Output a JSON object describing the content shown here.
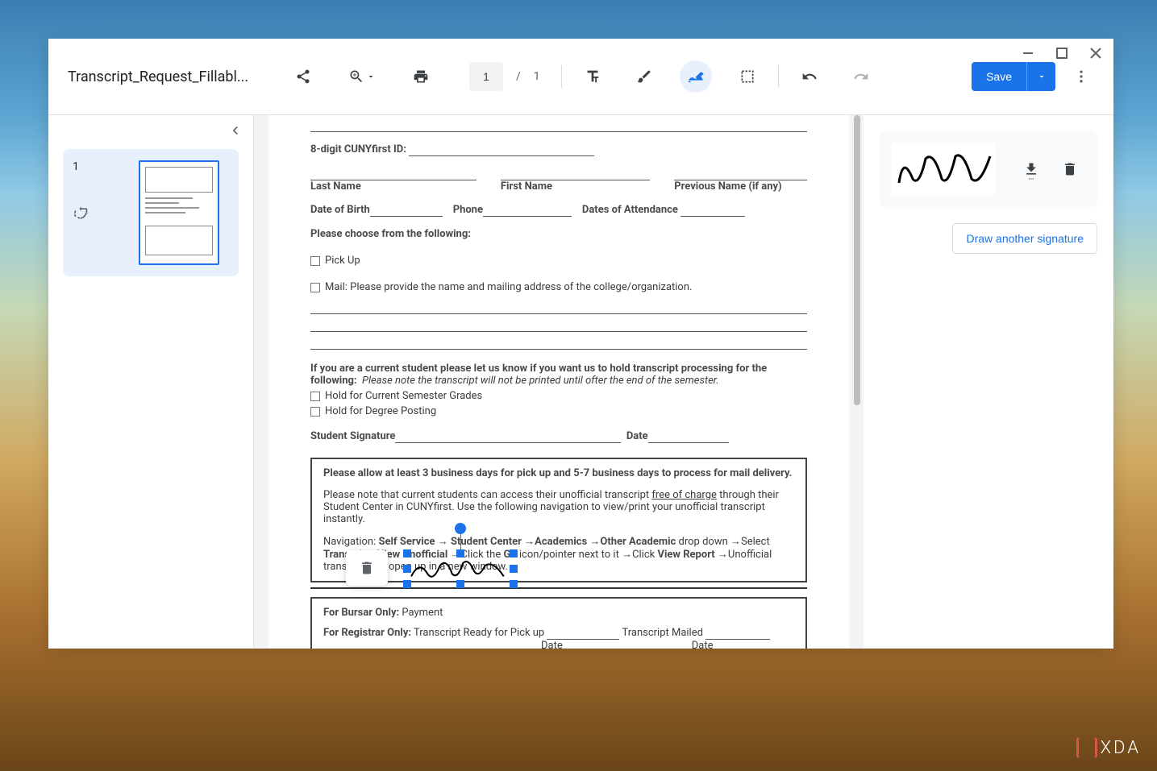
{
  "file_title": "Transcript_Request_Fillabl...",
  "toolbar": {
    "page_current": "1",
    "page_sep": "/",
    "page_total": "1",
    "save_label": "Save"
  },
  "sidebar": {
    "draw_another_label": "Draw another signature"
  },
  "thumbnail": {
    "page_num": "1"
  },
  "doc": {
    "cunyfirst_label": "8-digit CUNYfirst ID:",
    "last_name": "Last Name",
    "first_name": "First Name",
    "previous_name": "Previous Name (if any)",
    "dob": "Date of Birth",
    "phone": "Phone",
    "dates_attendance": "Dates of Attendance",
    "please_choose": "Please choose from the following:",
    "pickup": "Pick Up",
    "mail": "Mail: Please provide the name and mailing address of the college/organization.",
    "hold_intro_a": "If you are a current student please let us know if you want us to hold transcript processing for the following:",
    "hold_intro_b": "Please note the transcript will not be printed until ofter the end of the semester.",
    "hold_grades": "Hold for Current Semester Grades",
    "hold_degree": "Hold for Degree Posting",
    "sig_label": "Student Signature",
    "date_label": "Date",
    "box_bold": "Please allow at least 3 business days for pick up and 5-7 business days to process for mail delivery.",
    "box_p1a": "Please note that current students can access their unofficial transcript ",
    "box_p1_u": "free of charge",
    "box_p1b": " through their Student Center in CUNYfirst.  Use the following navigation to view/print your unofficial transcript instantly.",
    "nav_label": "Navigation: ",
    "nav_self_service": "Self Service",
    "nav_student_center": "Student Center",
    "nav_academics": "Academics",
    "nav_other_academic": "Other Academic",
    "nav_dropdown": " drop down ",
    "nav_select": "Select ",
    "nav_transcript": "Transcript: View Unofficial",
    "nav_click_the": "Click the ",
    "nav_go": "Go",
    "nav_icon_next": " icon/pointer next to it ",
    "nav_click": "Click ",
    "nav_view_report": "View Report",
    "nav_unofficial": "Unofficial transcript will open up in a new window.",
    "bursar_label": "For Bursar Only:",
    "bursar_text": " Payment",
    "registrar_label": "For Registrar Only:",
    "registrar_ready": " Transcript Ready for Pick up ",
    "registrar_mailed": " Transcript Mailed ",
    "date_footer": "Date"
  },
  "watermark": "XDA"
}
